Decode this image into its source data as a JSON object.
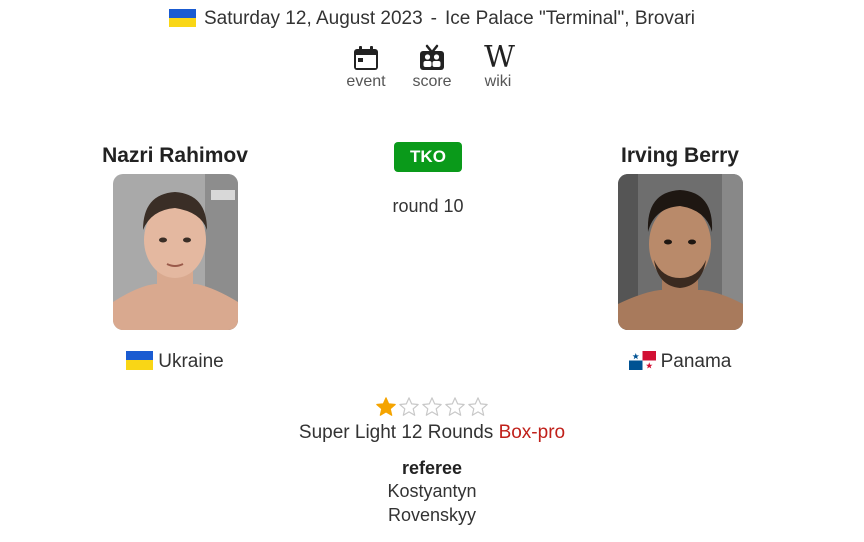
{
  "event": {
    "date": "Saturday 12, August 2023",
    "separator": "-",
    "venue": "Ice Palace \"Terminal\", Brovari",
    "country_flag": "ukraine"
  },
  "links": [
    {
      "label": "event",
      "icon": "calendar-icon"
    },
    {
      "label": "score",
      "icon": "scorecard-icon"
    },
    {
      "label": "wiki",
      "icon": "wikipedia-icon"
    }
  ],
  "fighters": {
    "left": {
      "name": "Nazri Rahimov",
      "country": "Ukraine",
      "flag": "ukraine"
    },
    "right": {
      "name": "Irving Berry",
      "country": "Panama",
      "flag": "panama"
    }
  },
  "result": {
    "method": "TKO",
    "round_text": "round 10",
    "method_color": "#0a9a1a"
  },
  "rating": {
    "filled": 1,
    "max": 5,
    "star_color": "#f5a400"
  },
  "bout": {
    "weight_rounds": "Super Light 12 Rounds",
    "type": "Box-pro",
    "type_color": "#c0201a"
  },
  "referee": {
    "heading": "referee",
    "first_name": "Kostyantyn",
    "last_name": "Rovenskyy"
  }
}
